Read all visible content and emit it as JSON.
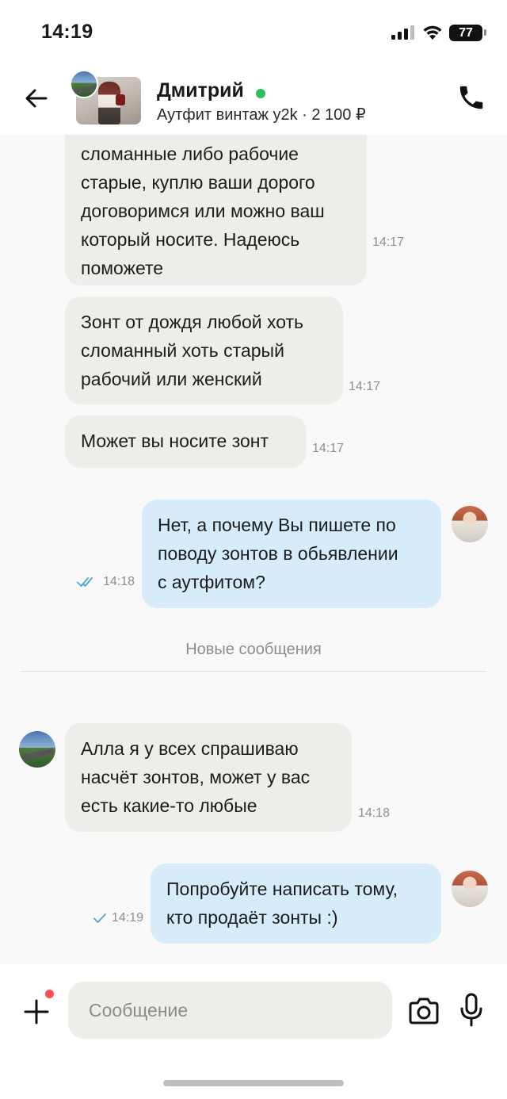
{
  "status_bar": {
    "time": "14:19",
    "battery": "77"
  },
  "header": {
    "back_icon": "arrow-left-icon",
    "seller_name": "Дмитрий",
    "online": true,
    "ad_info": "Аутфит винтаж y2k · 2 100 ₽",
    "call_icon": "phone-icon"
  },
  "messages": [
    {
      "direction": "in",
      "text": "сломанные либо рабочие\nстарые, куплю ваши дорого\nдоговоримся или можно ваш\nкоторый носите. Надеюсь\nпоможете",
      "time": "14:17"
    },
    {
      "direction": "in",
      "text": "Зонт от дождя любой хоть\nсломанный хоть старый\nрабочий или женский",
      "time": "14:17"
    },
    {
      "direction": "in",
      "text": "Может вы носите зонт",
      "time": "14:17"
    },
    {
      "direction": "out",
      "text": "Нет, а почему Вы пишете по\nповоду зонтов в обьявлении\nс аутфитом?",
      "time": "14:18",
      "status": "read"
    },
    {
      "direction": "in",
      "text": "Алла я у всех спрашиваю\nнасчёт зонтов, может у вас\nесть какие-то любые",
      "time": "14:18"
    },
    {
      "direction": "out",
      "text": "Попробуйте написать тому,\nкто продаёт зонты :)",
      "time": "14:19",
      "status": "sent"
    }
  ],
  "divider": {
    "label": "Новые сообщения"
  },
  "composer": {
    "placeholder": "Сообщение",
    "value": "",
    "attach_icon": "plus-icon",
    "camera_icon": "camera-icon",
    "mic_icon": "microphone-icon"
  },
  "colors": {
    "incoming_bubble": "#efedea",
    "outgoing_bubble": "#d6ecfb",
    "online": "#2cc15a",
    "read_check": "#4aa3e0",
    "badge": "#ff4d5a"
  }
}
